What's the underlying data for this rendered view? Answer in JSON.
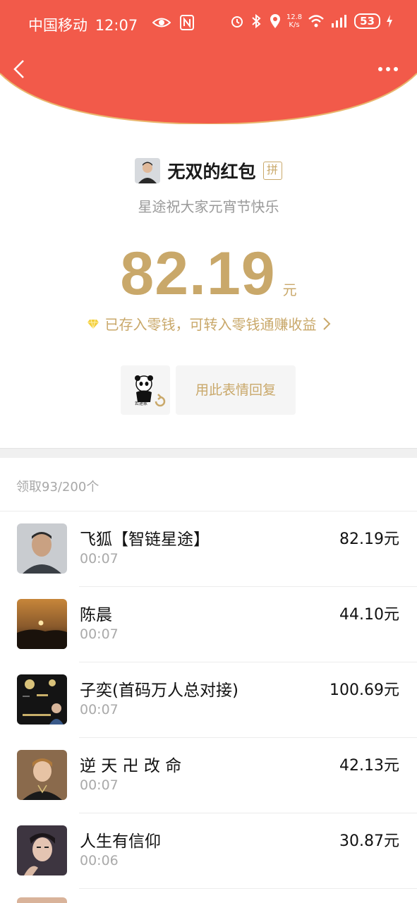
{
  "status_bar": {
    "carrier": "中国移动",
    "time": "12:07",
    "net_speed_value": "12.8",
    "net_speed_unit": "K/s",
    "battery": "53"
  },
  "header": {
    "back_icon": "chevron-left-icon",
    "more_icon": "more-dots-icon",
    "accent_color": "#f25a4a"
  },
  "sender": {
    "name": "无双的红包",
    "badge": "拼"
  },
  "greeting": "星途祝大家元宵节快乐",
  "amount": {
    "value": "82.19",
    "unit": "元",
    "color": "#c9a86a"
  },
  "saved_text": "已存入零钱，可转入零钱通赚收益",
  "reply": {
    "button_label": "用此表情回复",
    "sticker_text": "若途家"
  },
  "claim_count": "领取93/200个",
  "recipients": [
    {
      "name": "飞狐【智链星途】",
      "time": "00:07",
      "amount": "82.19元"
    },
    {
      "name": "陈晨",
      "time": "00:07",
      "amount": "44.10元"
    },
    {
      "name": "子奕(首码万人总对接)",
      "time": "00:07",
      "amount": "100.69元"
    },
    {
      "name": "逆 天 卍 改 命",
      "time": "00:07",
      "amount": "42.13元"
    },
    {
      "name": "人生有信仰",
      "time": "00:06",
      "amount": "30.87元"
    }
  ]
}
